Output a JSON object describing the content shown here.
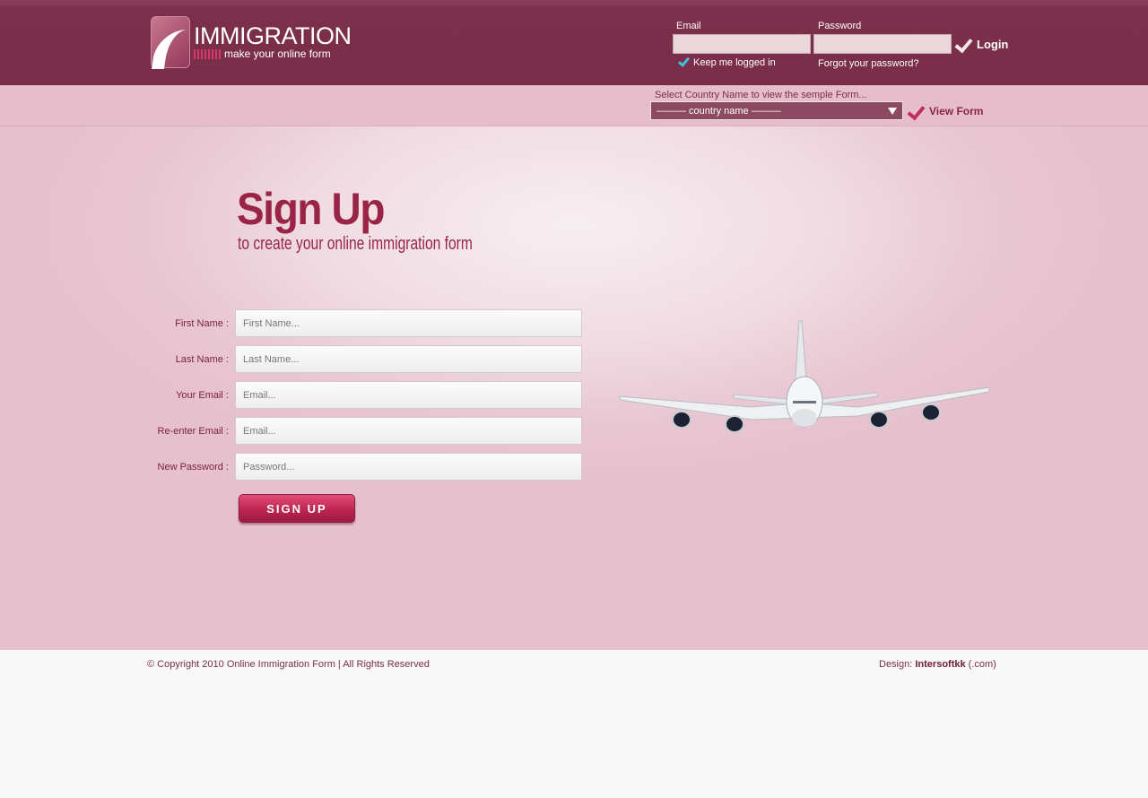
{
  "header": {
    "logo_title": "IMMIGRATION",
    "logo_subtitle": "make your online form",
    "email_label": "Email",
    "password_label": "Password",
    "login_label": "Login",
    "keep_logged_in": "Keep me logged in",
    "forgot_password": "Forgot your password?"
  },
  "country_bar": {
    "hint": "Select Country Name to view the semple Form...",
    "select_value": "——— country name ———",
    "view_form_label": "View Form"
  },
  "signup": {
    "title": "Sign Up",
    "subtitle": "to create your online immigration form",
    "fields": [
      {
        "label": "First Name :",
        "placeholder": "First Name..."
      },
      {
        "label": "Last Name :",
        "placeholder": "Last Name..."
      },
      {
        "label": "Your Email :",
        "placeholder": "Email..."
      },
      {
        "label": "Re-enter Email :",
        "placeholder": "Email..."
      },
      {
        "label": "New Password :",
        "placeholder": "Password..."
      }
    ],
    "button_label": "SIGN UP"
  },
  "footer": {
    "copyright": "© Copyright 2010 Online Immigration Form  |  All Rights Reserved",
    "design_prefix": "Design: ",
    "design_name": "Intersoftkk",
    "design_suffix": " (.com)"
  },
  "colors": {
    "header_bg": "#7a2e49",
    "country_bar_bg": "#e6bdca",
    "accent": "#9a2448",
    "button": "#c22e5d"
  }
}
